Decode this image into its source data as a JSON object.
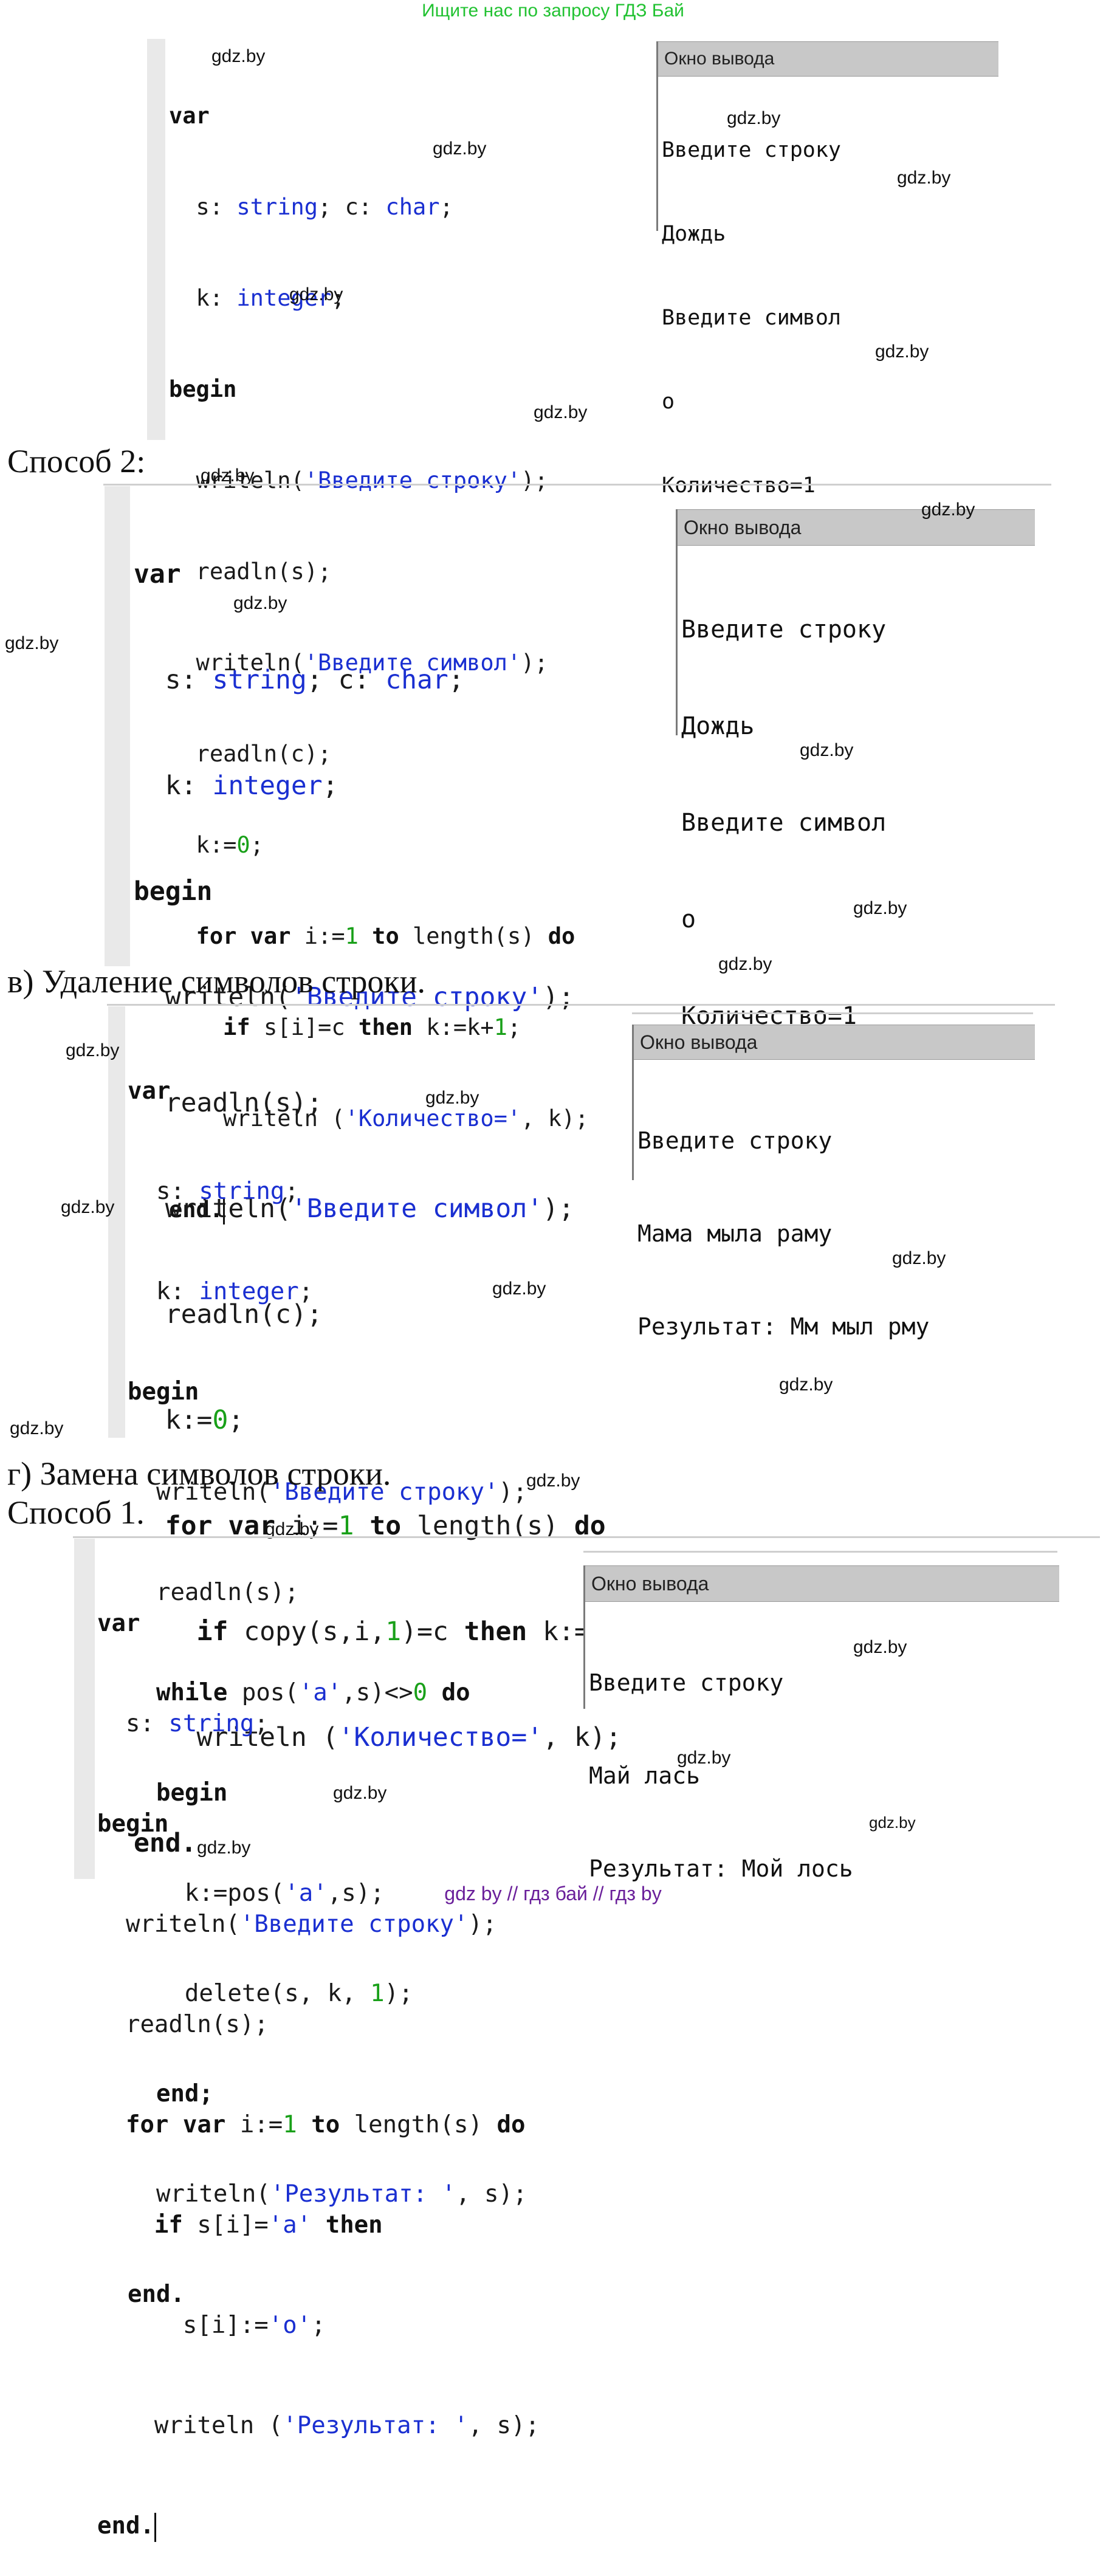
{
  "banner": "Ищите нас по запросу ГДЗ Бай",
  "watermark": "gdz.by",
  "footer": "gdz by  //  гдз бай  //  гдз by",
  "headings": {
    "method2": "Способ 2:",
    "section_v": "в) Удаление символов строки.",
    "section_g": "г) Замена символов строки.",
    "method1": "Способ 1."
  },
  "output_title": "Окно вывода",
  "block1": {
    "output": [
      "Введите строку",
      "Дождь",
      "Введите символ",
      "о",
      "Количество=1"
    ]
  },
  "block2": {
    "output": [
      "Введите строку",
      "Дождь",
      "Введите символ",
      "о",
      "Количество=1"
    ]
  },
  "block3": {
    "output": [
      "Введите строку",
      "Мама мыла раму",
      "Результат: Мм мыл рму"
    ]
  },
  "block4": {
    "output": [
      "Введите строку",
      "Май лась",
      "Результат: Мой лось"
    ]
  }
}
